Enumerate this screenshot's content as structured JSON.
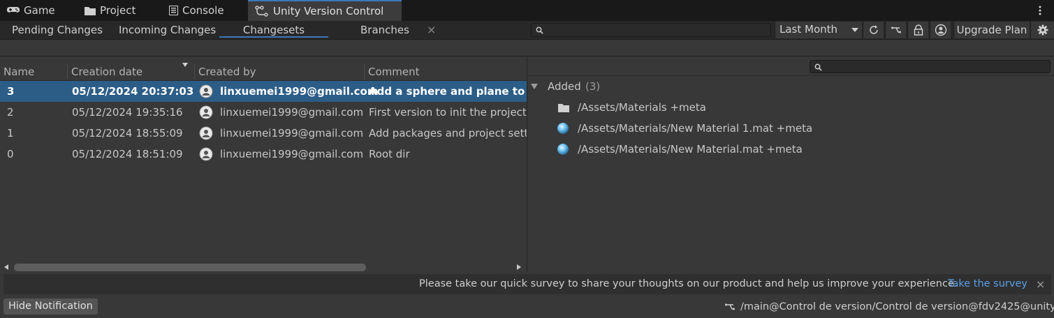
{
  "window_tabs": [
    {
      "label": "Game",
      "icon": "gamepad-icon"
    },
    {
      "label": "Project",
      "icon": "folder-icon"
    },
    {
      "label": "Console",
      "icon": "console-icon"
    },
    {
      "label": "Unity Version Control",
      "icon": "branch-graph-icon"
    }
  ],
  "sub_tabs": {
    "pending": "Pending Changes",
    "incoming": "Incoming Changes",
    "changesets": "Changesets",
    "branches": "Branches",
    "close_glyph": "×"
  },
  "toolbar": {
    "search_value": "",
    "date_filter": "Last Month",
    "upgrade_label": "Upgrade Plan"
  },
  "changesets_table": {
    "columns": [
      "Name",
      "Creation date",
      "Created by",
      "Comment"
    ],
    "rows": [
      {
        "name": "3",
        "date": "05/12/2024 20:37:03",
        "author": "linxuemei1999@gmail.com",
        "comment": "Add a sphere and plane to Scene",
        "selected": true
      },
      {
        "name": "2",
        "date": "05/12/2024 19:35:16",
        "author": "linxuemei1999@gmail.com",
        "comment": "First version to init the project",
        "selected": false
      },
      {
        "name": "1",
        "date": "05/12/2024 18:55:09",
        "author": "linxuemei1999@gmail.com",
        "comment": "Add packages and project settings",
        "selected": false
      },
      {
        "name": "0",
        "date": "05/12/2024 18:51:09",
        "author": "linxuemei1999@gmail.com",
        "comment": "Root dir",
        "selected": false
      }
    ]
  },
  "details": {
    "search_value": "",
    "group_label": "Added",
    "group_count": "(3)",
    "items": [
      {
        "path": "/Assets/Materials +meta",
        "icon": "folder-icon"
      },
      {
        "path": "/Assets/Materials/New Material 1.mat +meta",
        "icon": "material-sphere-icon"
      },
      {
        "path": "/Assets/Materials/New Material.mat +meta",
        "icon": "material-sphere-icon"
      }
    ]
  },
  "notification": {
    "message": "Please take our quick survey to share your thoughts on our product and help us improve your experience.",
    "link": "Take the survey",
    "close_glyph": "×"
  },
  "status": {
    "hide_label": "Hide Notification",
    "workspace_path": "/main@Control de version/Control de version@fdv2425@unity"
  },
  "colors": {
    "accent": "#3a79bb",
    "selection": "#2c5d87",
    "link": "#5aa0ea"
  }
}
